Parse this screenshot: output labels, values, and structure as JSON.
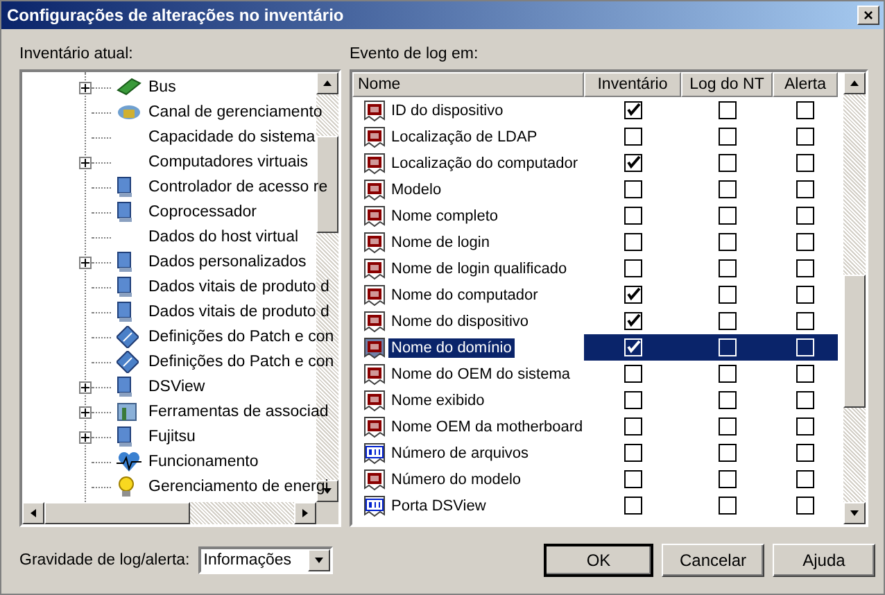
{
  "window": {
    "title": "Configurações de alterações no inventário",
    "close": "×"
  },
  "tree": {
    "label": "Inventário atual:",
    "items": [
      {
        "text": "Bus",
        "kind": "card",
        "expandable": true
      },
      {
        "text": "Canal de gerenciamento",
        "kind": "network",
        "expandable": false
      },
      {
        "text": "Capacidade do sistema",
        "kind": "plain",
        "expandable": false
      },
      {
        "text": "Computadores virtuais",
        "kind": "plain",
        "expandable": true
      },
      {
        "text": "Controlador de acesso re",
        "kind": "monitor",
        "expandable": false
      },
      {
        "text": "Coprocessador",
        "kind": "monitor",
        "expandable": false
      },
      {
        "text": "Dados do host virtual",
        "kind": "plain",
        "expandable": false
      },
      {
        "text": "Dados personalizados",
        "kind": "monitor",
        "expandable": true
      },
      {
        "text": "Dados vitais de produto d",
        "kind": "monitor",
        "expandable": false
      },
      {
        "text": "Dados vitais de produto d",
        "kind": "monitor",
        "expandable": false
      },
      {
        "text": "Definições do Patch e con",
        "kind": "diamond",
        "expandable": false
      },
      {
        "text": "Definições do Patch e con",
        "kind": "diamond",
        "expandable": false
      },
      {
        "text": "DSView",
        "kind": "monitor",
        "expandable": true
      },
      {
        "text": "Ferramentas de associad",
        "kind": "tool",
        "expandable": true
      },
      {
        "text": "Fujitsu",
        "kind": "monitor",
        "expandable": true
      },
      {
        "text": "Funcionamento",
        "kind": "heart",
        "expandable": false
      },
      {
        "text": "Gerenciamento de energi",
        "kind": "bulb",
        "expandable": false
      }
    ]
  },
  "events": {
    "label": "Evento de log em:",
    "columns": [
      "Nome",
      "Inventário",
      "Log do NT",
      "Alerta"
    ],
    "rows": [
      {
        "name": "ID do dispositivo",
        "kind": "text",
        "selected": false,
        "inventory": true,
        "nt_log": false,
        "alert": false
      },
      {
        "name": "Localização de LDAP",
        "kind": "text",
        "selected": false,
        "inventory": false,
        "nt_log": false,
        "alert": false
      },
      {
        "name": "Localização do computador",
        "kind": "text",
        "selected": false,
        "inventory": true,
        "nt_log": false,
        "alert": false
      },
      {
        "name": "Modelo",
        "kind": "text",
        "selected": false,
        "inventory": false,
        "nt_log": false,
        "alert": false
      },
      {
        "name": "Nome completo",
        "kind": "text",
        "selected": false,
        "inventory": false,
        "nt_log": false,
        "alert": false
      },
      {
        "name": "Nome de login",
        "kind": "text",
        "selected": false,
        "inventory": false,
        "nt_log": false,
        "alert": false
      },
      {
        "name": "Nome de login qualificado",
        "kind": "text",
        "selected": false,
        "inventory": false,
        "nt_log": false,
        "alert": false
      },
      {
        "name": "Nome do computador",
        "kind": "text",
        "selected": false,
        "inventory": true,
        "nt_log": false,
        "alert": false
      },
      {
        "name": "Nome do dispositivo",
        "kind": "text",
        "selected": false,
        "inventory": true,
        "nt_log": false,
        "alert": false
      },
      {
        "name": "Nome do domínio",
        "kind": "text",
        "selected": true,
        "inventory": true,
        "nt_log": false,
        "alert": false
      },
      {
        "name": "Nome do OEM do sistema",
        "kind": "text",
        "selected": false,
        "inventory": false,
        "nt_log": false,
        "alert": false
      },
      {
        "name": "Nome exibido",
        "kind": "text",
        "selected": false,
        "inventory": false,
        "nt_log": false,
        "alert": false
      },
      {
        "name": "Nome OEM da motherboard",
        "kind": "text",
        "selected": false,
        "inventory": false,
        "nt_log": false,
        "alert": false
      },
      {
        "name": "Número de arquivos",
        "kind": "number",
        "selected": false,
        "inventory": false,
        "nt_log": false,
        "alert": false
      },
      {
        "name": "Número do modelo",
        "kind": "text",
        "selected": false,
        "inventory": false,
        "nt_log": false,
        "alert": false
      },
      {
        "name": "Porta DSView",
        "kind": "number",
        "selected": false,
        "inventory": false,
        "nt_log": false,
        "alert": false
      }
    ]
  },
  "severity": {
    "label": "Gravidade de log/alerta:",
    "value": "Informações"
  },
  "buttons": [
    {
      "label": "OK",
      "default": true
    },
    {
      "label": "Cancelar",
      "default": false
    },
    {
      "label": "Ajuda",
      "default": false
    }
  ]
}
